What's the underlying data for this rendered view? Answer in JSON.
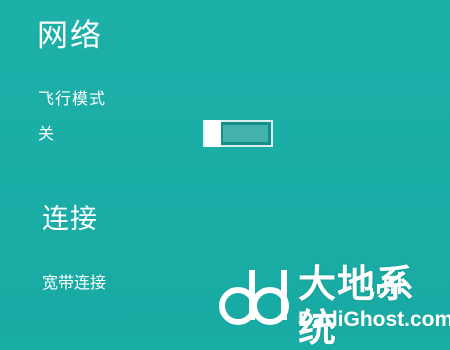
{
  "network": {
    "title": "网络",
    "airplane_mode": {
      "label": "飞行模式",
      "state_text": "关",
      "enabled": false
    },
    "connections": {
      "heading": "连接",
      "items": [
        {
          "name": "宽带连接",
          "icon": "signal-bars-icon"
        }
      ]
    }
  },
  "watermark": {
    "title": "大地系统",
    "url": "DadiGhost.com"
  },
  "colors": {
    "background": "#1aada6",
    "text": "#ffffff",
    "toggle_fill": "#148f89"
  }
}
